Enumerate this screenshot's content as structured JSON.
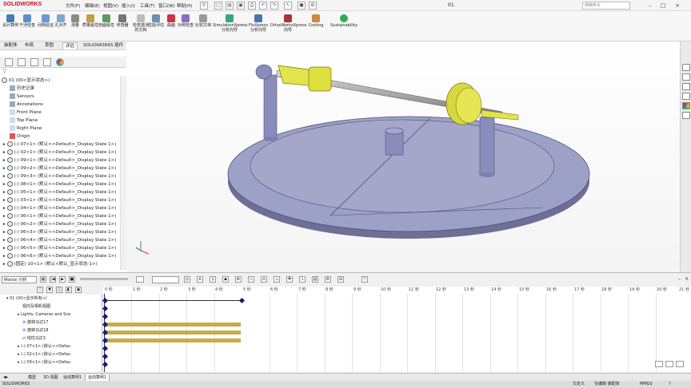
{
  "app": {
    "brand": "SOLIDWORKS",
    "status_app": "SOLIDWORKS",
    "document_title": "01"
  },
  "menu": [
    "文件(F)",
    "编辑(E)",
    "视图(V)",
    "插入(I)",
    "工具(T)",
    "窗口(W)",
    "帮助(H)"
  ],
  "search_placeholder": "搜索命令",
  "ribbon": {
    "tools": [
      "设计算例",
      "干涉检查",
      "间隙验证",
      "孔对齐",
      "测量",
      "质量属性",
      "剖面属性",
      "传感器",
      "检查激活的文档",
      "性能评估",
      "曲面",
      "对称检查",
      "比较文档",
      "SimulationXpress 分析向导",
      "FloXpress 分析向导",
      "DriveWorksXpress 向导",
      "Costing",
      "Sustainability"
    ]
  },
  "command_tabs": [
    "装配体",
    "布局",
    "草图",
    "评估",
    "SOLIDWORKS 插件"
  ],
  "active_command_tab": "评估",
  "feature_tree": {
    "root": "01 (00<显示状态>)",
    "items": [
      "历史记录",
      "Sensors",
      "Annotations",
      "Front Plane",
      "Top Plane",
      "Right Plane",
      "Origin",
      "(-) 07<1> (默认<<Default>_Display State 1>)",
      "(-) 02<1> (默认<<Default>_Display State 1>)",
      "(-) 09<1> (默认<<Default>_Display State 1>)",
      "(-) 09<2> (默认<<Default>_Display State 1>)",
      "(-) 09<3> (默认<<Default>_Display State 1>)",
      "(-) 08<1> (默认<<Default>_Display State 1>)",
      "(-) 05<1> (默认<<Default>_Display State 1>)",
      "(-) 03<1> (默认<<Default>_Display State 1>)",
      "(-) 04<1> (默认<<Default>_Display State 1>)",
      "(-) 06<1> (默认<<Default>_Display State 1>)",
      "(-) 06<2> (默认<<Default>_Display State 1>)",
      "(-) 06<3> (默认<<Default>_Display State 1>)",
      "(-) 06<4> (默认<<Default>_Display State 1>)",
      "(-) 06<5> (默认<<Default>_Display State 1>)",
      "(-) 06<6> (默认<<Default>_Display State 1>)",
      "(固定) 10<1> (默认<默认_显示状态-1>)"
    ]
  },
  "motion": {
    "study_type": "Motion 分析",
    "tree": [
      "01 (00<显示所有>)",
      "视向及相机视图",
      "Lights, Cameras and Sce",
      "旋转马达17",
      "旋转马达18",
      "线性马达3",
      "(-) 07<1> (默认<<Defau",
      "(-) 02<1> (默认<<Defau",
      "(-) 09<1> (默认<<Defau"
    ],
    "ticks": [
      "0 秒",
      "1 秒",
      "2 秒",
      "3 秒",
      "4 秒",
      "5 秒",
      "6 秒",
      "7 秒",
      "8 秒",
      "9 秒",
      "10 秒",
      "11 秒",
      "12 秒",
      "13 秒",
      "14 秒",
      "15 秒",
      "16 秒",
      "17 秒",
      "18 秒",
      "19 秒",
      "20 秒",
      "21 秒"
    ]
  },
  "bottom_tabs": [
    "模型",
    "3D 视图",
    "运动算例1",
    "运动算例1"
  ],
  "status": {
    "left": "SOLIDWORKS",
    "defined": "欠定义",
    "editing": "在编辑 装配体",
    "units": "MMGS"
  },
  "colors": {
    "accent": "#c8102e",
    "motor_bar": "#c9ab4c",
    "keyframe": "#1b1b6a",
    "model_base": "#9ea1c7",
    "model_shaft": "#e3e34b"
  }
}
